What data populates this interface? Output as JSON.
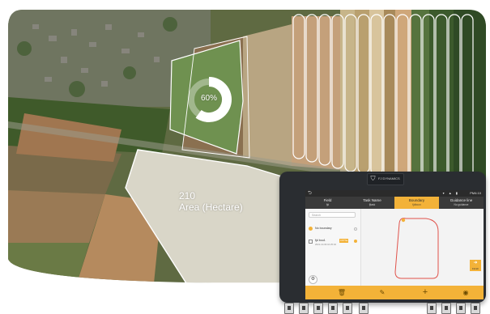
{
  "overlay": {
    "progress_label": "60%",
    "progress_fraction": 0.6,
    "area_value": "210",
    "area_unit": "Area (Hectare)"
  },
  "device": {
    "brand": "FJ DYNAMICS",
    "status": {
      "back_icon": "back-icon",
      "time": "PM4:10",
      "icons": "▾ ▲ ▮"
    },
    "steps": [
      {
        "title": "Field",
        "subtitle": "fjd"
      },
      {
        "title": "Task Name",
        "subtitle": "fjtask"
      },
      {
        "title": "Boundary",
        "subtitle": "fjdboun"
      },
      {
        "title": "Guidance line",
        "subtitle": "No guidance"
      }
    ],
    "sidebar": {
      "search_placeholder": "Search",
      "items": [
        {
          "label": "No boundary"
        },
        {
          "label": "fjd bou1",
          "badge": "0.87ha",
          "sub": "2021-10-09 10:25:04"
        }
      ]
    },
    "finish_label": "Finish",
    "toolbar_icons": [
      "trash-icon",
      "edit-icon",
      "plus-icon",
      "record-icon"
    ],
    "colors": {
      "accent": "#f3b238",
      "boundary": "#e0524a",
      "dark": "#2b2b2b"
    }
  }
}
